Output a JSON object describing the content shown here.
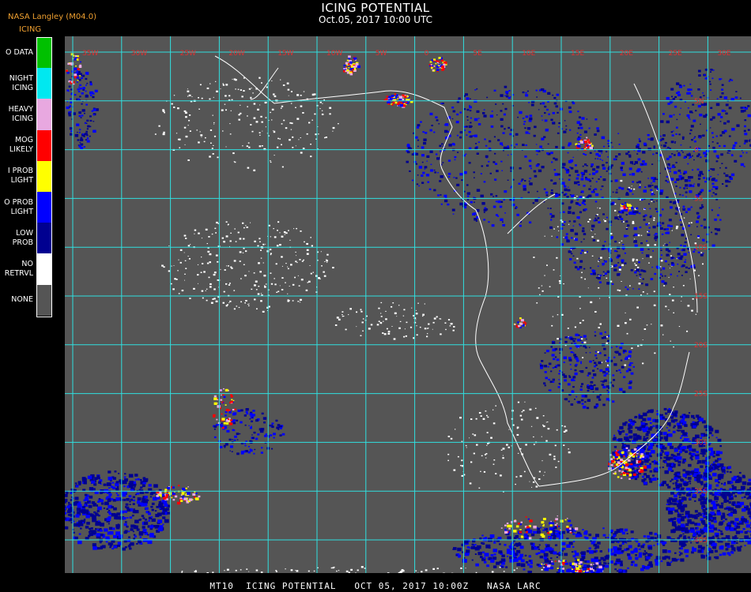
{
  "header": {
    "title": "ICING POTENTIAL",
    "subtitle": "Oct.05, 2017 10:00 UTC",
    "source": "NASA Langley (M04.0)",
    "legend_title": "ICING"
  },
  "legend": {
    "items": [
      {
        "label": "O DATA",
        "color": "#00c000"
      },
      {
        "label": "NIGHT\nICING",
        "color": "#00e8f0"
      },
      {
        "label": "HEAVY\nICING",
        "color": "#e8a8e0"
      },
      {
        "label": "MOG\nLIKELY",
        "color": "#ff0000"
      },
      {
        "label": "I PROB\nLIGHT",
        "color": "#ffff00"
      },
      {
        "label": "O PROB\nLIGHT",
        "color": "#0000ff"
      },
      {
        "label": "LOW\nPROB",
        "color": "#000090"
      },
      {
        "label": "NO\nRETRVL",
        "color": "#ffffff"
      },
      {
        "label": "NONE",
        "color": "#555555"
      }
    ]
  },
  "map": {
    "background": "#555555",
    "grid_color": "#30e0e0",
    "coast_color": "#ffffff",
    "label_color": "#e03030",
    "top_labels": [
      "35W",
      "30W",
      "25W",
      "20W",
      "15W",
      "10W",
      "5W",
      "0",
      "5E",
      "10E",
      "15E",
      "20E",
      "25E",
      "30E",
      "35E"
    ],
    "right_labels": [
      "5N",
      "0",
      "5S",
      "10S",
      "15S",
      "20S",
      "25S",
      "30S",
      "35S",
      "40S"
    ]
  },
  "footer": {
    "text": "MT10  ICING POTENTIAL   OCT 05, 2017 10:00Z   NASA LARC"
  }
}
